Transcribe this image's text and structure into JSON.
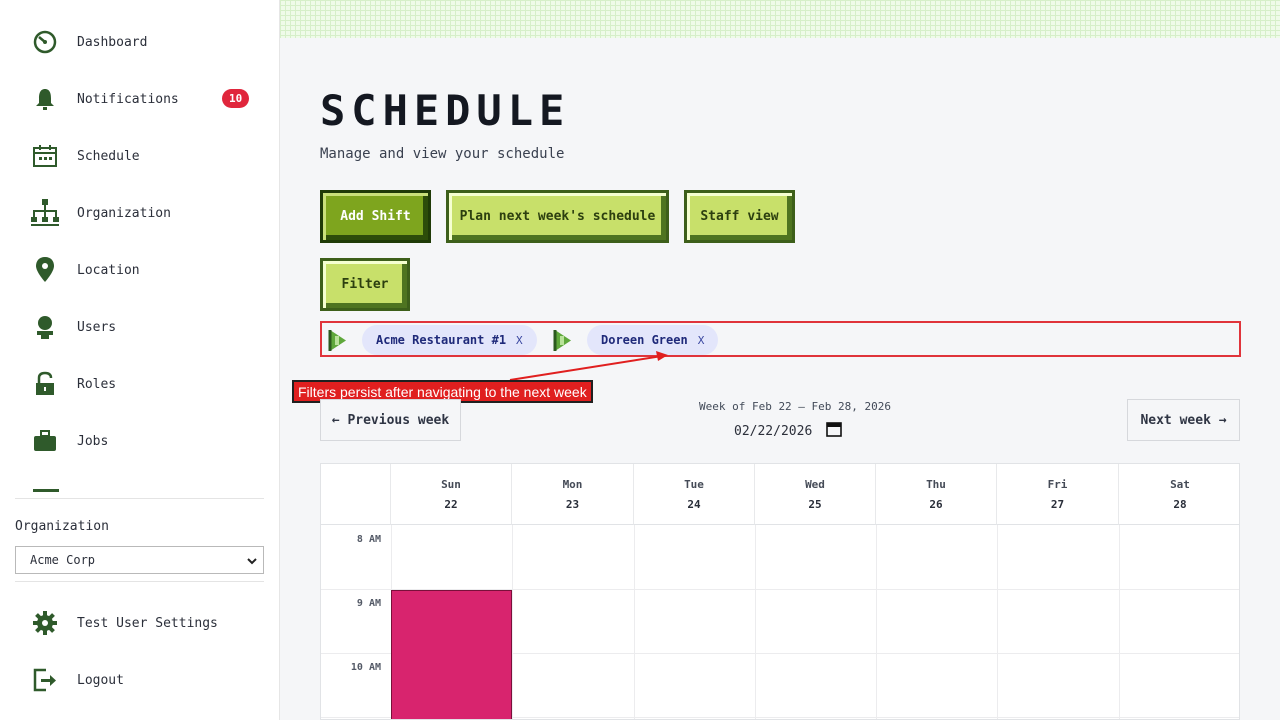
{
  "sidebar": {
    "items": [
      {
        "label": "Dashboard",
        "icon": "dashboard-icon"
      },
      {
        "label": "Notifications",
        "icon": "bell-icon",
        "badge": "10"
      },
      {
        "label": "Schedule",
        "icon": "calendar-icon"
      },
      {
        "label": "Organization",
        "icon": "org-chart-icon"
      },
      {
        "label": "Location",
        "icon": "location-pin-icon"
      },
      {
        "label": "Users",
        "icon": "user-icon"
      },
      {
        "label": "Roles",
        "icon": "lock-icon"
      },
      {
        "label": "Jobs",
        "icon": "briefcase-icon"
      }
    ],
    "organization_label": "Organization",
    "organization_selected": "Acme Corp",
    "footer_items": [
      {
        "label": "Test User Settings",
        "icon": "gear-icon"
      },
      {
        "label": "Logout",
        "icon": "logout-icon"
      }
    ]
  },
  "main": {
    "title": "SCHEDULE",
    "subtitle": "Manage and view your schedule",
    "buttons": {
      "add_shift": "Add Shift",
      "plan_next_week": "Plan next week's schedule",
      "staff_view": "Staff view",
      "filter": "Filter"
    },
    "filters": [
      {
        "label": "Acme Restaurant #1",
        "remove": "X"
      },
      {
        "label": "Doreen Green",
        "remove": "X"
      }
    ],
    "annotation": "Filters persist after navigating to the next week",
    "week_nav": {
      "previous": "← Previous week",
      "next": "Next week →",
      "week_label": "Week of Feb 22 – Feb 28, 2026",
      "date_value": "02/22/2026"
    }
  },
  "calendar": {
    "days": [
      {
        "name": "Sun",
        "date": "22"
      },
      {
        "name": "Mon",
        "date": "23"
      },
      {
        "name": "Tue",
        "date": "24"
      },
      {
        "name": "Wed",
        "date": "25"
      },
      {
        "name": "Thu",
        "date": "26"
      },
      {
        "name": "Fri",
        "date": "27"
      },
      {
        "name": "Sat",
        "date": "28"
      }
    ],
    "hours": [
      "8 AM",
      "9 AM",
      "10 AM"
    ],
    "shift_color": "#d8246e"
  },
  "colors": {
    "accent_green": "#7ea51e",
    "light_green": "#c8e06a",
    "badge_red": "#e0263c",
    "annotation_red": "#e01f1f",
    "chip_bg": "#e3e6fb"
  }
}
